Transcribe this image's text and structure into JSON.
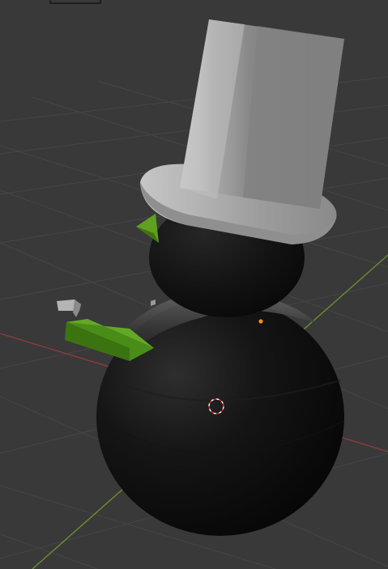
{
  "app": {
    "view": "3D Viewport",
    "shading": "solid"
  },
  "scene": {
    "objects": [
      {
        "name": "hat",
        "icon": "top-hat-mesh",
        "color": "#bfbfbf"
      },
      {
        "name": "head",
        "icon": "sphere-mesh",
        "color": "#0e0e0e"
      },
      {
        "name": "body",
        "icon": "sphere-mesh",
        "color": "#0b0b0b"
      },
      {
        "name": "nose",
        "icon": "cone-mesh",
        "color": "#5a9a1e"
      },
      {
        "name": "arm",
        "icon": "box-mesh",
        "color": "#4a8a18"
      }
    ],
    "axes": {
      "x_color": "#8c3a3f",
      "y_color": "#6a8f2e"
    },
    "grid_color": "#4a4a4a",
    "background": "#393939",
    "origin_color": "#f0901a",
    "cursor_colors": [
      "#cc2a2a",
      "#ffffff"
    ]
  }
}
